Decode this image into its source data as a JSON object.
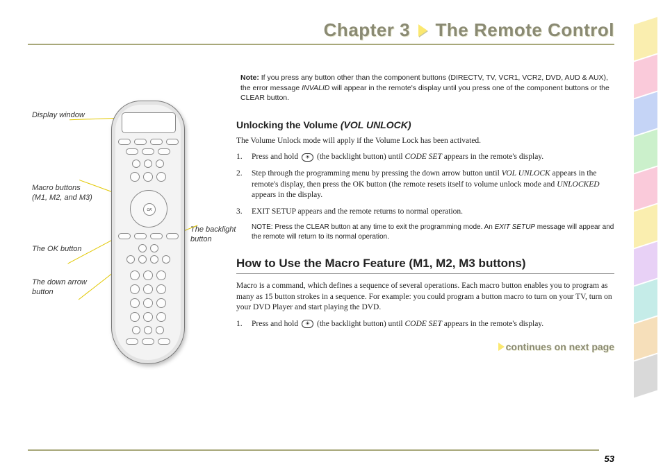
{
  "chapter": {
    "label": "Chapter 3",
    "title": "The Remote Control"
  },
  "note": {
    "prefix": "Note:",
    "body1": "If you press any button other than the component buttons (DIRECTV, TV, VCR1, VCR2, DVD, AUD & AUX), the error message ",
    "invalid": "INVALID",
    "body2": " will appear in the remote's display until you press one of the component buttons or the CLEAR button."
  },
  "section_unlock": {
    "title_plain": "Unlocking the Volume ",
    "title_italic": "(VOL UNLOCK)",
    "intro": "The Volume Unlock mode will apply if the Volume Lock has been activated.",
    "step1a": "Press and hold ",
    "step1b": " (the backlight button) until ",
    "step1c": "CODE SET",
    "step1d": " appears in the remote's display.",
    "step2a": "Step through the programming menu by pressing the down arrow button until ",
    "step2b": "VOL UNLOCK",
    "step2c": " appears in the remote's display, then press the OK button (the remote resets itself to volume unlock mode and ",
    "step2d": "UNLOCKED",
    "step2e": " appears in the display.",
    "step3": "EXIT SETUP appears and the remote returns to normal operation.",
    "inner_note_a": "NOTE: Press the CLEAR button at any time to exit the programming mode. An ",
    "inner_note_b": "EXIT SETUP",
    "inner_note_c": " message will appear and the remote will return to its normal operation."
  },
  "section_macro": {
    "heading": "How to Use the Macro Feature (M1, M2, M3 buttons)",
    "intro": "Macro is a command, which defines a sequence of several operations. Each macro button enables you to program as many as 15 button strokes in a sequence. For example: you could program a button macro to turn on your TV, turn on your DVD Player and start playing the DVD.",
    "step1a": "Press and hold ",
    "step1b": " (the backlight button) until ",
    "step1c": "CODE SET",
    "step1d": " appears in the remote's display."
  },
  "continues": "continues on next page",
  "page_number": "53",
  "callouts": {
    "display": "Display window",
    "macro": "Macro buttons (M1, M2, and M3)",
    "ok": "The OK button",
    "down": "The down arrow button",
    "backlight": "The backlight button"
  },
  "tab_colors": [
    "#f7e27a",
    "#f7a6c2",
    "#9fb8f0",
    "#a8e6a8",
    "#f7a6c2",
    "#f7e27a",
    "#d9b3f0",
    "#9fe0d9",
    "#f0c98c",
    "#c0c0c0"
  ],
  "backlight_glyph": "☀"
}
